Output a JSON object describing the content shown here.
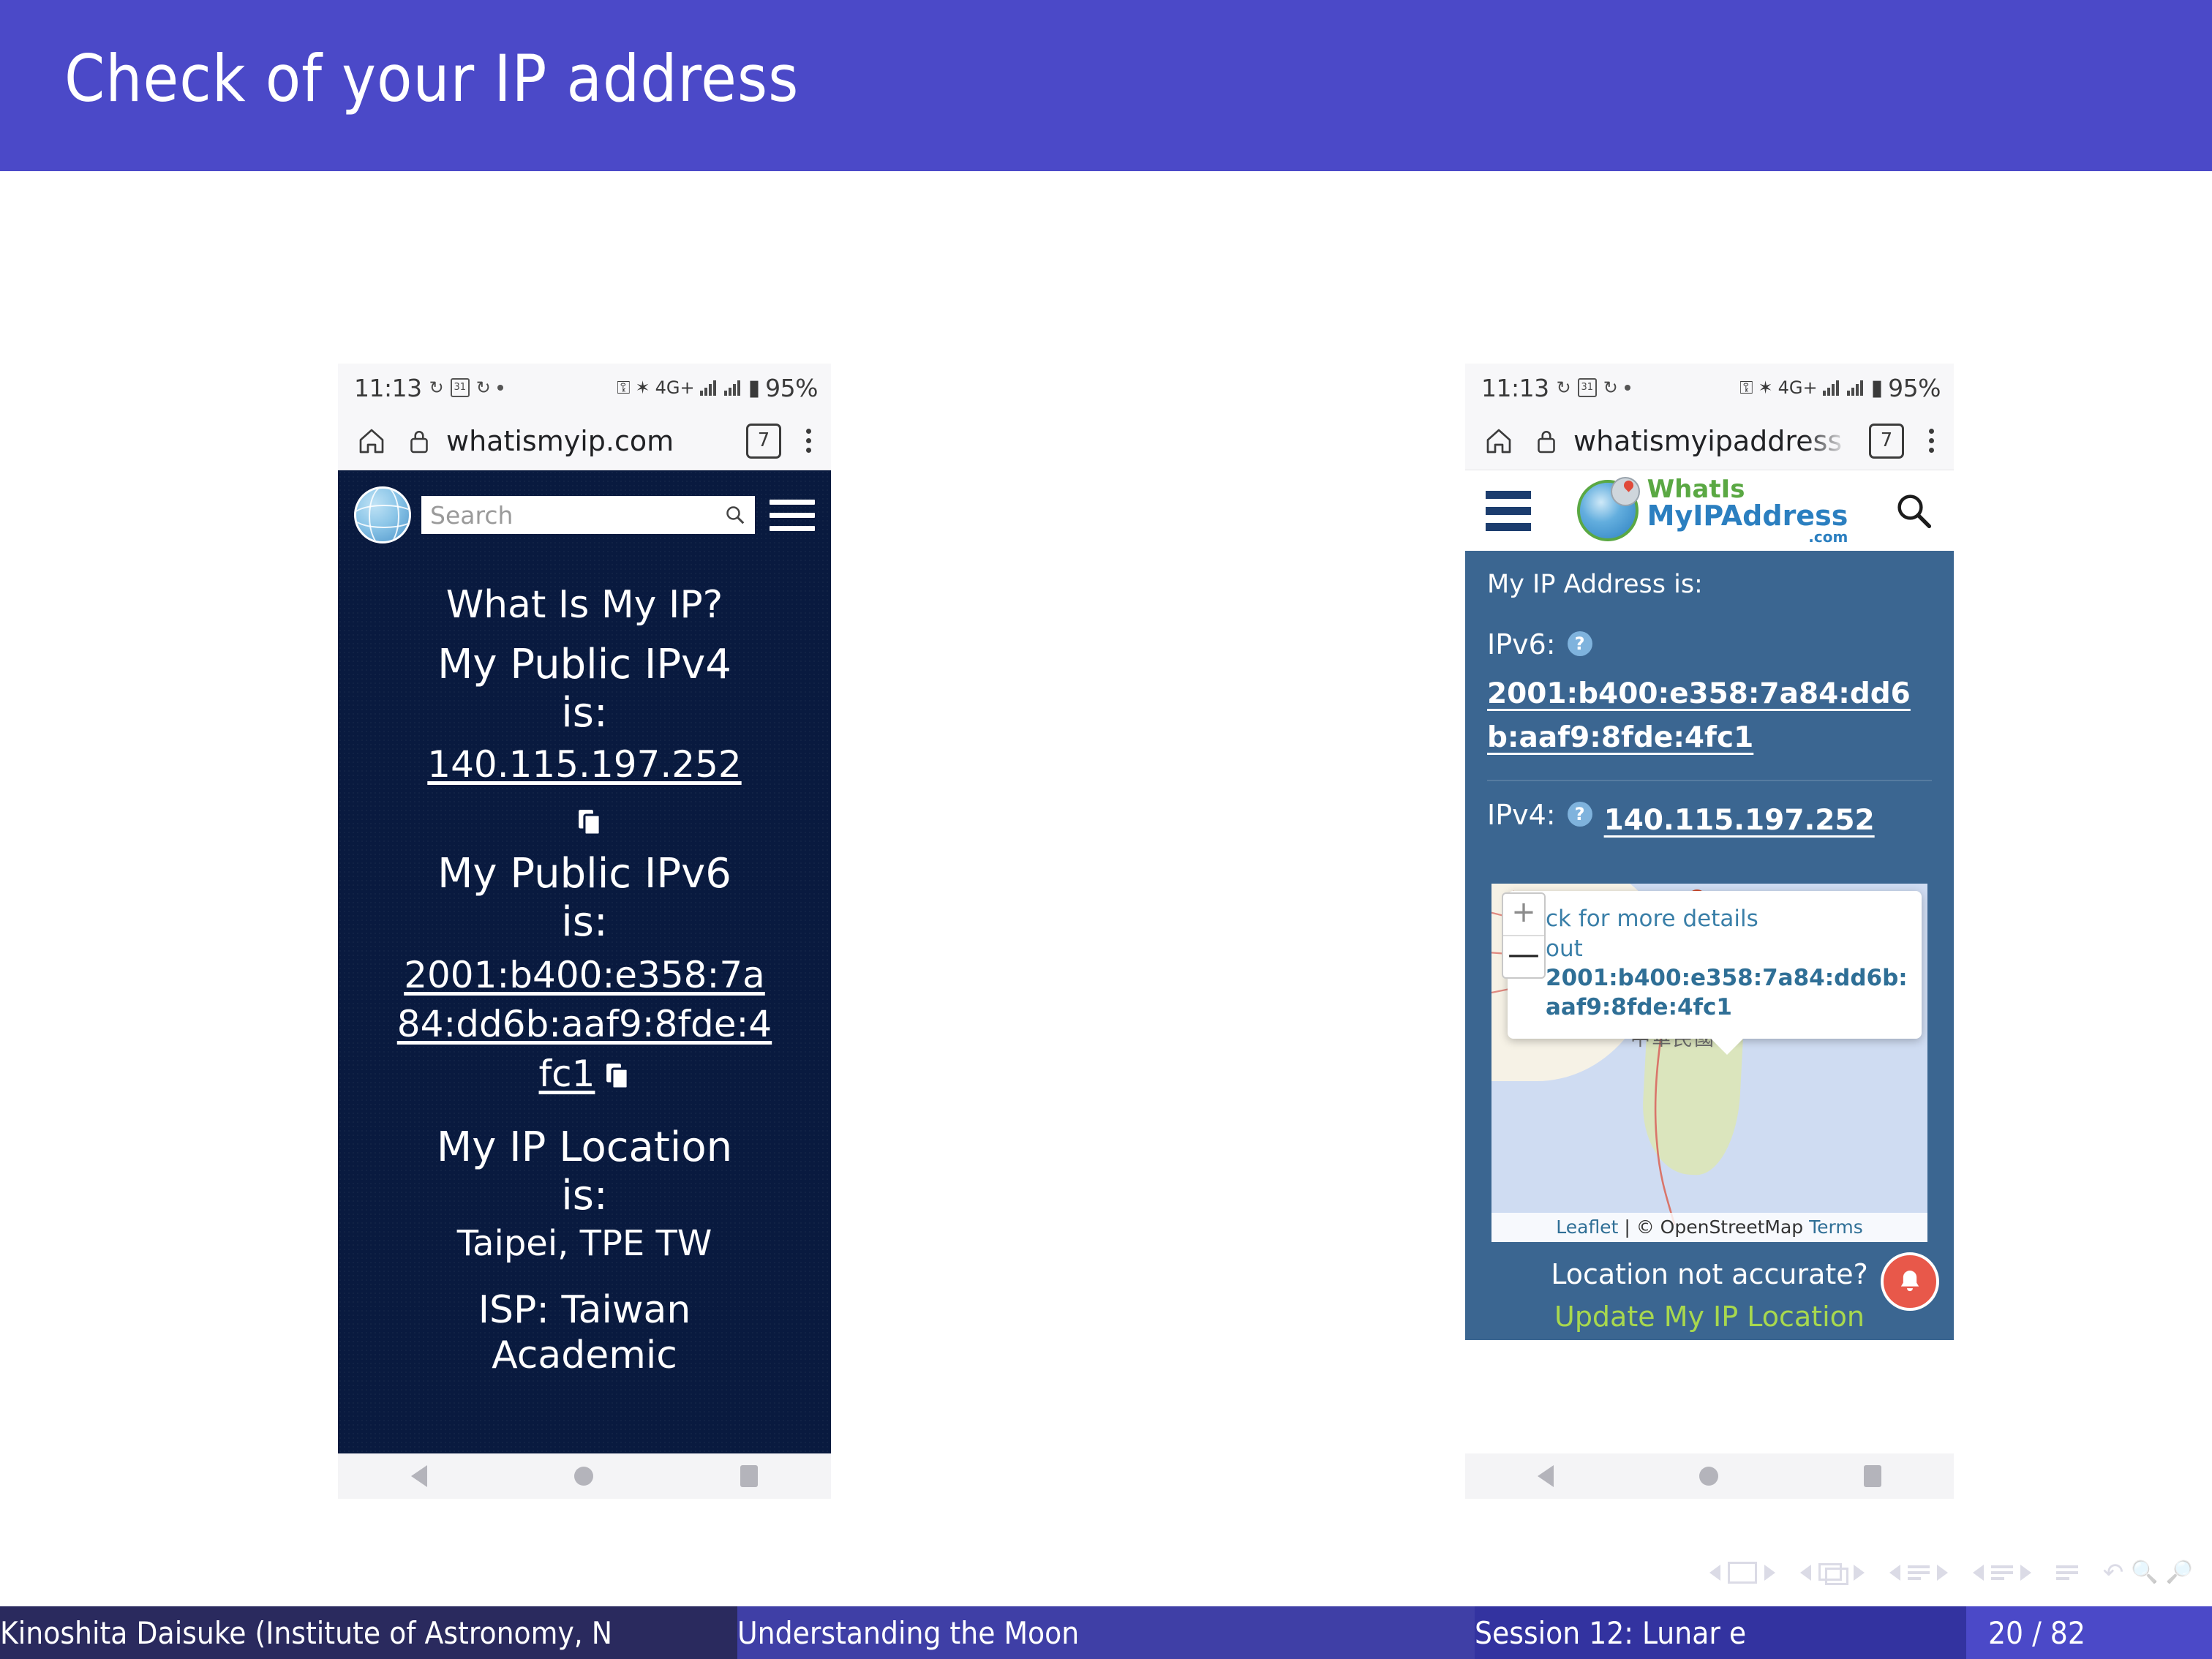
{
  "slide": {
    "title": "Check of your IP address",
    "title_bar_color": "#4B49C8"
  },
  "footline": {
    "author": "Kinoshita Daisuke (Institute of Astronomy, N",
    "title": "Understanding the Moon",
    "session": "Session 12: Lunar e",
    "page": "20 / 82"
  },
  "beamer_nav": {
    "undo_icon": "undo-icon",
    "zoom_in_icon": "zoom-in-icon",
    "zoom_out_icon": "zoom-out-icon"
  },
  "phone_left": {
    "status_bar": {
      "time": "11:13",
      "network": "4G+",
      "battery_percent": "95%",
      "calendar_day": "31"
    },
    "browser": {
      "url": "whatismyip.com",
      "tab_count": "7"
    },
    "site": {
      "search_placeholder": "Search",
      "heading": "What Is My IP?",
      "ipv4_label": "My Public IPv4",
      "is_word": "is:",
      "ipv4_value": "140.115.197.252",
      "ipv6_label": "My Public IPv6",
      "ipv6_line1": "2001:b400:e358:7a",
      "ipv6_line2": "84:dd6b:aaf9:8fde:4",
      "ipv6_line3": "fc1",
      "location_label": "My IP Location",
      "location_value": "Taipei, TPE TW",
      "isp_value": "ISP: Taiwan",
      "isp_value_cut": "Academic"
    }
  },
  "phone_right": {
    "status_bar": {
      "time": "11:13",
      "network": "4G+",
      "battery_percent": "95%",
      "calendar_day": "31"
    },
    "browser": {
      "url": "whatismyipaddress",
      "tab_count": "7"
    },
    "site": {
      "brand_part1": "WhatIs",
      "brand_part2": "MyIPAddress",
      "brand_part3": ".com",
      "ip_block_label": "My IP Address is:",
      "ipv6_key": "IPv6:",
      "ipv6_value": "2001:b400:e358:7a84:dd6b:aaf9:8fde:4fc1",
      "ipv4_key": "IPv4:",
      "ipv4_value": "140.115.197.252",
      "help_marker": "?",
      "map": {
        "popup_line1": "ck for more details",
        "popup_line2": "out",
        "popup_ip": "2001:b400:e358:7a84:dd6b:aaf9:8fde:4fc1",
        "country_label": "中華民國",
        "zoom_in": "+",
        "zoom_out": "—",
        "attribution_leaflet": "Leaflet",
        "attribution_sep": "|",
        "attribution_osm": "© OpenStreetMap",
        "attribution_terms": "Terms"
      },
      "not_accurate": "Location not accurate?",
      "update_link": "Update My IP Location"
    }
  }
}
